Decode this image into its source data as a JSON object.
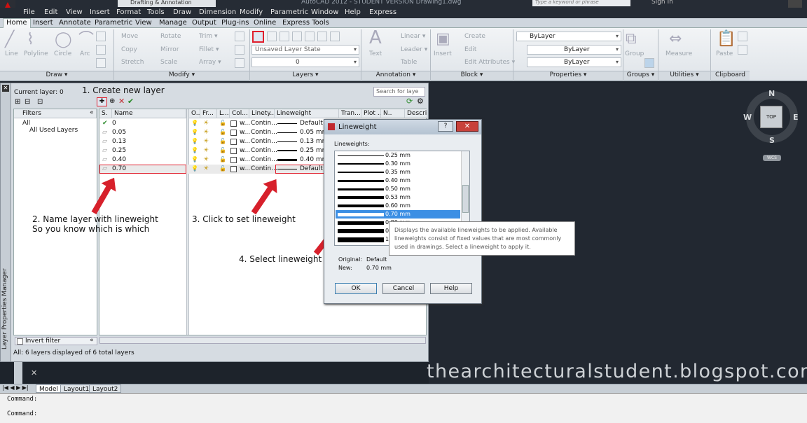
{
  "app": {
    "workspace": "Drafting & Annotation",
    "title": "AutoCAD 2012 - STUDENT VERSION    Drawing1.dwg",
    "search_placeholder": "Type a keyword or phrase",
    "signin": "Sign In"
  },
  "menu": [
    "File",
    "Edit",
    "View",
    "Insert",
    "Format",
    "Tools",
    "Draw",
    "Dimension",
    "Modify",
    "Parametric",
    "Window",
    "Help",
    "Express"
  ],
  "ribbon_tabs": [
    "Home",
    "Insert",
    "Annotate",
    "Parametric",
    "View",
    "Manage",
    "Output",
    "Plug-ins",
    "Online",
    "Express Tools"
  ],
  "ribbon": {
    "draw": {
      "panel": "Draw ▾",
      "tools": [
        "Line",
        "Polyline",
        "Circle",
        "Arc"
      ]
    },
    "modify": {
      "panel": "Modify ▾",
      "tools": [
        "Move",
        "Rotate",
        "Trim ▾",
        "Copy",
        "Mirror",
        "Fillet ▾",
        "Stretch",
        "Scale",
        "Array ▾"
      ]
    },
    "layers": {
      "panel": "Layers ▾",
      "state": "Unsaved Layer State",
      "current": "0"
    },
    "annotation": {
      "panel": "Annotation ▾",
      "text": "Text",
      "tools": [
        "Linear ▾",
        "Leader ▾",
        "Table"
      ]
    },
    "block": {
      "panel": "Block ▾",
      "insert": "Insert",
      "tools": [
        "Create",
        "Edit",
        "Edit Attributes ▾"
      ]
    },
    "properties": {
      "panel": "Properties ▾",
      "color": "ByLayer",
      "linetype": "ByLayer",
      "lineweight": "ByLayer"
    },
    "groups": {
      "panel": "Groups ▾",
      "label": "Group"
    },
    "utilities": {
      "panel": "Utilities ▾",
      "label": "Measure"
    },
    "clipboard": {
      "panel": "Clipboard",
      "label": "Paste"
    }
  },
  "lpm": {
    "side_label": "Layer Properties Manager",
    "current_layer": "Current layer: 0",
    "search_placeholder": "Search for laye",
    "filters_label": "Filters",
    "tree": [
      "All",
      "All Used Layers"
    ],
    "columns": [
      "S.",
      "Name",
      "O..",
      "Fr...",
      "L...",
      "Col...",
      "Linety...",
      "Lineweight",
      "Tran...",
      "Plot ...",
      "N..",
      "Descri..."
    ],
    "layers": [
      {
        "name": "0",
        "color": "w...",
        "linetype": "Contin...",
        "lineweight": "Default",
        "weight_val": 1
      },
      {
        "name": "0.05",
        "color": "w...",
        "linetype": "Contin...",
        "lineweight": "0.05 mm",
        "weight_val": 1
      },
      {
        "name": "0.13",
        "color": "w...",
        "linetype": "Contin...",
        "lineweight": "0.13 mm",
        "weight_val": 1
      },
      {
        "name": "0.25",
        "color": "w...",
        "linetype": "Contin...",
        "lineweight": "0.25 mm",
        "weight_val": 2
      },
      {
        "name": "0.40",
        "color": "w...",
        "linetype": "Contin...",
        "lineweight": "0.40 mm",
        "weight_val": 3
      },
      {
        "name": "0.70",
        "color": "w...",
        "linetype": "Contin...",
        "lineweight": "Default",
        "weight_val": 1
      }
    ],
    "invert_filter": "Invert filter",
    "status": "All: 6 layers displayed of 6 total layers"
  },
  "dialog": {
    "title": "Lineweight",
    "list_label": "Lineweights:",
    "items": [
      {
        "label": "0.25 mm",
        "w": 1
      },
      {
        "label": "0.30 mm",
        "w": 2
      },
      {
        "label": "0.35 mm",
        "w": 2
      },
      {
        "label": "0.40 mm",
        "w": 3
      },
      {
        "label": "0.50 mm",
        "w": 3
      },
      {
        "label": "0.53 mm",
        "w": 4
      },
      {
        "label": "0.60 mm",
        "w": 4
      },
      {
        "label": "0.70 mm",
        "w": 5
      },
      {
        "label": "0.80 mm",
        "w": 5
      },
      {
        "label": "0.90 mm",
        "w": 6
      },
      {
        "label": "1.00 mm",
        "w": 7
      }
    ],
    "original_label": "Original:",
    "original_value": "Default",
    "new_label": "New:",
    "new_value": "0.70 mm",
    "ok": "OK",
    "cancel": "Cancel",
    "help": "Help",
    "tooltip": "Displays the available lineweights to be applied. Available lineweights consist of fixed values that are most commonly used in drawings. Select a lineweight to apply it."
  },
  "annotations": {
    "step1": "1. Create new layer",
    "step2a": "2. Name layer with lineweight",
    "step2b": "So you know which is which",
    "step3": "3. Click to set lineweight",
    "step4": "4. Select lineweight"
  },
  "viewcube": {
    "n": "N",
    "s": "S",
    "e": "E",
    "w": "W",
    "top": "TOP",
    "wcs": "WCS"
  },
  "watermark": "thearchitecturalstudent.blogspot.com",
  "layout_tabs": [
    "Model",
    "Layout1",
    "Layout2"
  ],
  "command": [
    "Command:",
    "Command:"
  ]
}
